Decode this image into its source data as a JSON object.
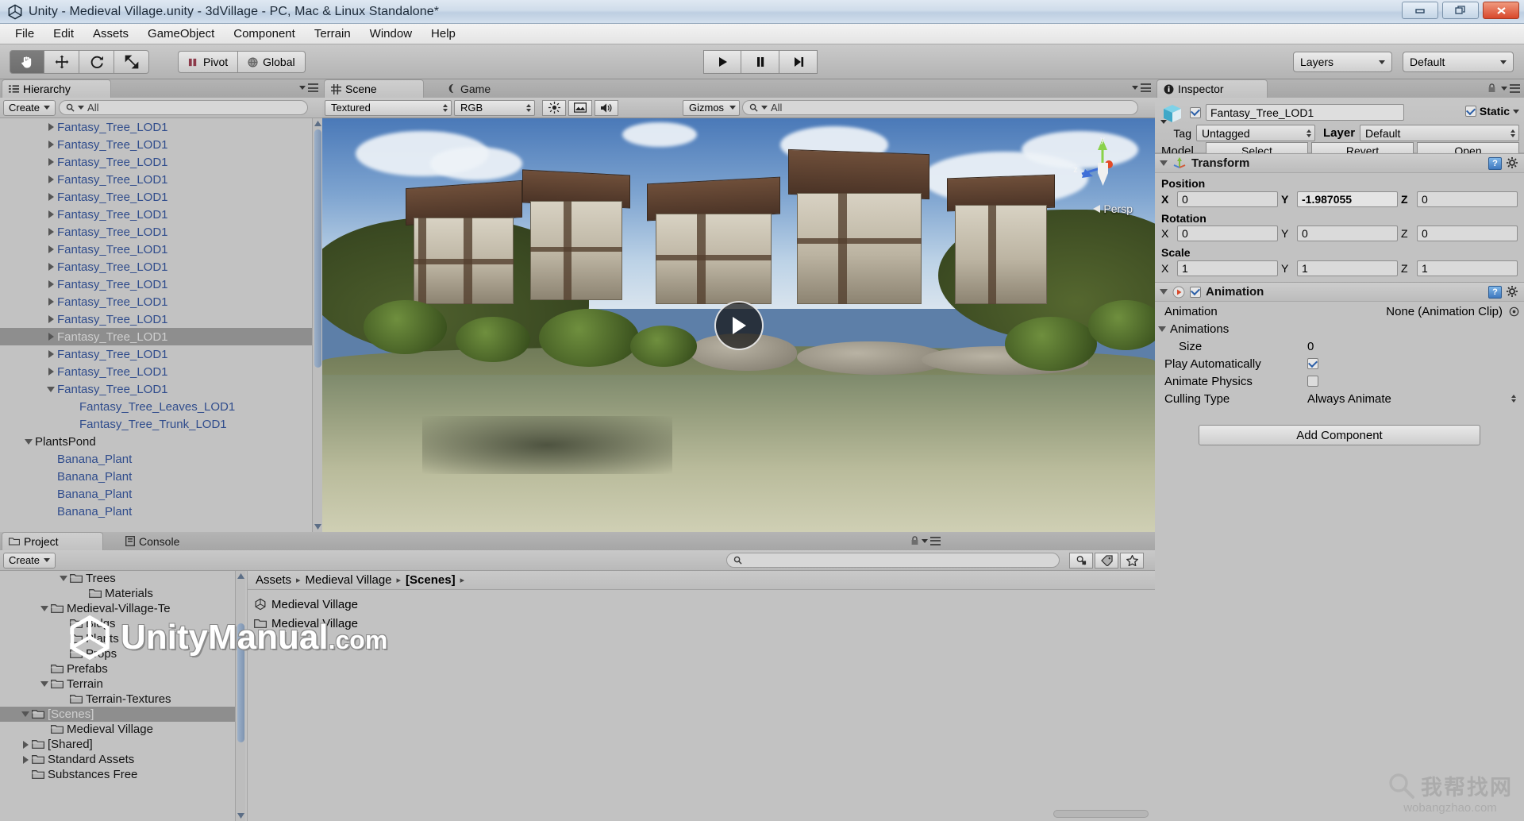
{
  "window": {
    "title": "Unity - Medieval Village.unity - 3dVillage - PC, Mac & Linux Standalone*",
    "app_icon": "unity-icon",
    "minimize_label": "Minimize",
    "restore_label": "Restore",
    "close_label": "Close"
  },
  "menubar": {
    "items": [
      {
        "label": "File"
      },
      {
        "label": "Edit"
      },
      {
        "label": "Assets"
      },
      {
        "label": "GameObject"
      },
      {
        "label": "Component"
      },
      {
        "label": "Terrain"
      },
      {
        "label": "Window"
      },
      {
        "label": "Help"
      }
    ]
  },
  "toolbar": {
    "tools": [
      {
        "name": "hand-tool",
        "active": true
      },
      {
        "name": "move-tool",
        "active": false
      },
      {
        "name": "rotate-tool",
        "active": false
      },
      {
        "name": "scale-tool",
        "active": false
      }
    ],
    "pivot_label": "Pivot",
    "global_label": "Global",
    "play_label": "Play",
    "pause_label": "Pause",
    "step_label": "Step",
    "layers_label": "Layers",
    "layout_label": "Default"
  },
  "hierarchy": {
    "tab_label": "Hierarchy",
    "create_label": "Create",
    "search_placeholder": "All",
    "search_value": "",
    "items": [
      {
        "label": "Fantasy_Tree_LOD1",
        "indent": 2,
        "toggle": "right",
        "kind": "prefab",
        "selected": false
      },
      {
        "label": "Fantasy_Tree_LOD1",
        "indent": 2,
        "toggle": "right",
        "kind": "prefab",
        "selected": false
      },
      {
        "label": "Fantasy_Tree_LOD1",
        "indent": 2,
        "toggle": "right",
        "kind": "prefab",
        "selected": false
      },
      {
        "label": "Fantasy_Tree_LOD1",
        "indent": 2,
        "toggle": "right",
        "kind": "prefab",
        "selected": false
      },
      {
        "label": "Fantasy_Tree_LOD1",
        "indent": 2,
        "toggle": "right",
        "kind": "prefab",
        "selected": false
      },
      {
        "label": "Fantasy_Tree_LOD1",
        "indent": 2,
        "toggle": "right",
        "kind": "prefab",
        "selected": false
      },
      {
        "label": "Fantasy_Tree_LOD1",
        "indent": 2,
        "toggle": "right",
        "kind": "prefab",
        "selected": false
      },
      {
        "label": "Fantasy_Tree_LOD1",
        "indent": 2,
        "toggle": "right",
        "kind": "prefab",
        "selected": false
      },
      {
        "label": "Fantasy_Tree_LOD1",
        "indent": 2,
        "toggle": "right",
        "kind": "prefab",
        "selected": false
      },
      {
        "label": "Fantasy_Tree_LOD1",
        "indent": 2,
        "toggle": "right",
        "kind": "prefab",
        "selected": false
      },
      {
        "label": "Fantasy_Tree_LOD1",
        "indent": 2,
        "toggle": "right",
        "kind": "prefab",
        "selected": false
      },
      {
        "label": "Fantasy_Tree_LOD1",
        "indent": 2,
        "toggle": "right",
        "kind": "prefab",
        "selected": false
      },
      {
        "label": "Fantasy_Tree_LOD1",
        "indent": 2,
        "toggle": "right",
        "kind": "prefab",
        "selected": true
      },
      {
        "label": "Fantasy_Tree_LOD1",
        "indent": 2,
        "toggle": "right",
        "kind": "prefab",
        "selected": false
      },
      {
        "label": "Fantasy_Tree_LOD1",
        "indent": 2,
        "toggle": "right",
        "kind": "prefab",
        "selected": false
      },
      {
        "label": "Fantasy_Tree_LOD1",
        "indent": 2,
        "toggle": "down",
        "kind": "prefab",
        "selected": false
      },
      {
        "label": "Fantasy_Tree_Leaves_LOD1",
        "indent": 3,
        "toggle": "none",
        "kind": "prefab",
        "selected": false
      },
      {
        "label": "Fantasy_Tree_Trunk_LOD1",
        "indent": 3,
        "toggle": "none",
        "kind": "prefab",
        "selected": false
      },
      {
        "label": "PlantsPond",
        "indent": 1,
        "toggle": "down",
        "kind": "plain",
        "selected": false
      },
      {
        "label": "Banana_Plant",
        "indent": 2,
        "toggle": "none",
        "kind": "prefab",
        "selected": false
      },
      {
        "label": "Banana_Plant",
        "indent": 2,
        "toggle": "none",
        "kind": "prefab",
        "selected": false
      },
      {
        "label": "Banana_Plant",
        "indent": 2,
        "toggle": "none",
        "kind": "prefab",
        "selected": false
      },
      {
        "label": "Banana_Plant",
        "indent": 2,
        "toggle": "none",
        "kind": "prefab",
        "selected": false
      }
    ]
  },
  "scene": {
    "tab_scene_label": "Scene",
    "tab_game_label": "Game",
    "draw_mode": "Textured",
    "color_mode": "RGB",
    "gizmos_label": "Gizmos",
    "search_placeholder": "All",
    "search_value": "",
    "persp_label": "Persp",
    "axis_y": "y",
    "axis_z": "z",
    "video_play_label": "Play video"
  },
  "inspector": {
    "tab_label": "Inspector",
    "object_name": "Fantasy_Tree_LOD1",
    "object_enabled": true,
    "static_label": "Static",
    "static_checked": true,
    "tag_label": "Tag",
    "tag_value": "Untagged",
    "layer_label": "Layer",
    "layer_value": "Default",
    "model_label": "Model",
    "model_buttons": [
      "Select",
      "Revert",
      "Open"
    ],
    "transform": {
      "title": "Transform",
      "position_label": "Position",
      "rotation_label": "Rotation",
      "scale_label": "Scale",
      "position": {
        "x": "0",
        "y": "-1.987055",
        "z": "0"
      },
      "rotation": {
        "x": "0",
        "y": "0",
        "z": "0"
      },
      "scale": {
        "x": "1",
        "y": "1",
        "z": "1"
      },
      "axis_labels": {
        "x": "X",
        "y": "Y",
        "z": "Z"
      }
    },
    "animation": {
      "title": "Animation",
      "enabled": true,
      "rows": [
        {
          "label": "Animation",
          "value": "None (Animation Clip)",
          "type": "object"
        },
        {
          "label": "Animations",
          "value": "",
          "type": "foldout"
        },
        {
          "label": "Size",
          "value": "0",
          "type": "text"
        },
        {
          "label": "Play Automatically",
          "value": "",
          "type": "checkbox",
          "checked": true
        },
        {
          "label": "Animate Physics",
          "value": "",
          "type": "checkbox",
          "checked": false
        },
        {
          "label": "Culling Type",
          "value": "Always Animate",
          "type": "enum"
        }
      ]
    },
    "add_component_label": "Add Component"
  },
  "project": {
    "tab_project_label": "Project",
    "tab_console_label": "Console",
    "create_label": "Create",
    "search_placeholder": "",
    "search_value": "",
    "tree": [
      {
        "label": "Trees",
        "indent": 3,
        "toggle": "down",
        "selected": false
      },
      {
        "label": "Materials",
        "indent": 4,
        "toggle": "none",
        "selected": false
      },
      {
        "label": "Medieval-Village-Te",
        "indent": 2,
        "toggle": "down",
        "selected": false
      },
      {
        "label": "Bldgs",
        "indent": 3,
        "toggle": "none",
        "selected": false
      },
      {
        "label": "Plants",
        "indent": 3,
        "toggle": "none",
        "selected": false
      },
      {
        "label": "Props",
        "indent": 3,
        "toggle": "none",
        "selected": false
      },
      {
        "label": "Prefabs",
        "indent": 2,
        "toggle": "none",
        "selected": false
      },
      {
        "label": "Terrain",
        "indent": 2,
        "toggle": "down",
        "selected": false
      },
      {
        "label": "Terrain-Textures",
        "indent": 3,
        "toggle": "none",
        "selected": false
      },
      {
        "label": "[Scenes]",
        "indent": 1,
        "toggle": "down",
        "selected": true
      },
      {
        "label": "Medieval Village",
        "indent": 2,
        "toggle": "none",
        "selected": false
      },
      {
        "label": "[Shared]",
        "indent": 1,
        "toggle": "right",
        "selected": false
      },
      {
        "label": "Standard Assets",
        "indent": 1,
        "toggle": "right",
        "selected": false
      },
      {
        "label": "Substances Free",
        "indent": 1,
        "toggle": "none",
        "selected": false
      }
    ],
    "breadcrumb": [
      "Assets",
      "Medieval Village",
      "[Scenes]"
    ],
    "files": [
      {
        "label": "Medieval Village",
        "icon": "unity-scene-icon"
      },
      {
        "label": "Medieval Village",
        "icon": "folder-icon"
      }
    ],
    "icons": [
      "favorite-search-icon",
      "label-icon",
      "star-icon"
    ]
  },
  "watermark": {
    "brand": "UnityManual",
    "tld": ".com",
    "logo": "unity-logo-icon",
    "corner_cn": "我帮找网",
    "corner_en": "wobangzhao.com",
    "corner_icon": "magnifier-icon"
  },
  "colors": {
    "panel_bg": "#c2c2c2",
    "prefab_text": "#2f4c8c",
    "selection": "#8e8e8e",
    "accent_blue": "#3f79bf"
  }
}
